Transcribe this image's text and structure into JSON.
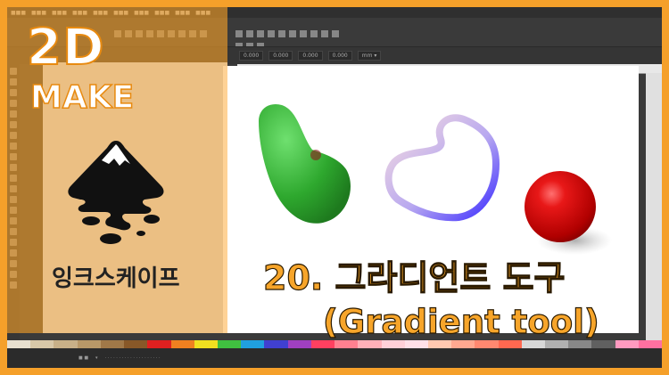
{
  "brand": {
    "logo_top": "2D",
    "logo_bottom": "MAKE",
    "app_name_korean": "잉크스케이프"
  },
  "title": {
    "line1": "20. 그라디언트 도구",
    "line2": "(Gradient tool)"
  },
  "colors": {
    "frame_orange": "#f5a02a",
    "title_fill": "#f7a52a",
    "app_dark": "#3a3a3a",
    "green_shape": "#2ea82e",
    "red_sphere": "#d10a0a",
    "stroke_gradient_start": "#7a5cff",
    "stroke_gradient_end": "#f3c2c2"
  },
  "icons": [
    "inkscape-logo-icon",
    "selector-tool-icon",
    "node-tool-icon",
    "zoom-tool-icon",
    "rectangle-tool-icon",
    "ellipse-tool-icon",
    "star-tool-icon",
    "pen-tool-icon",
    "pencil-tool-icon",
    "text-tool-icon",
    "gradient-tool-icon",
    "dropper-tool-icon"
  ]
}
